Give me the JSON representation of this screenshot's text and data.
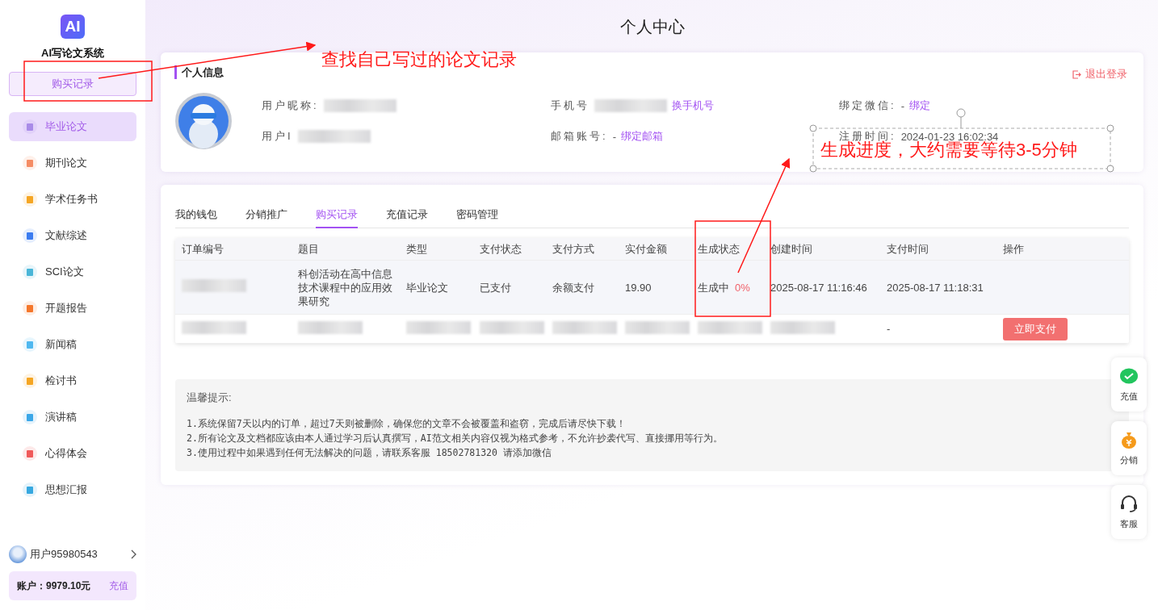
{
  "sidebar": {
    "logo": "AI",
    "app_name": "AI写论文系统",
    "top_button": "购买记录",
    "items": [
      {
        "label": "毕业论文",
        "selected": true,
        "color": "#a98be8"
      },
      {
        "label": "期刊论文",
        "selected": false,
        "color": "#f58c64"
      },
      {
        "label": "学术任务书",
        "selected": false,
        "color": "#f5a623"
      },
      {
        "label": "文献综述",
        "selected": false,
        "color": "#3b7cf0"
      },
      {
        "label": "SCI论文",
        "selected": false,
        "color": "#4ab6d8"
      },
      {
        "label": "开题报告",
        "selected": false,
        "color": "#f5772b"
      },
      {
        "label": "新闻稿",
        "selected": false,
        "color": "#4fb8f0"
      },
      {
        "label": "检讨书",
        "selected": false,
        "color": "#f5a623"
      },
      {
        "label": "演讲稿",
        "selected": false,
        "color": "#3aa7e8"
      },
      {
        "label": "心得体会",
        "selected": false,
        "color": "#f05a5a"
      },
      {
        "label": "思想汇报",
        "selected": false,
        "color": "#36a8e0"
      }
    ],
    "user": "用户95980543",
    "balance": "账户：9979.10元",
    "recharge": "充值"
  },
  "page_title": "个人中心",
  "profile": {
    "title": "个人信息",
    "logout": "退出登录",
    "fields": [
      {
        "label": "用户昵称:",
        "blurred": true
      },
      {
        "label": "手机号",
        "blurred": true,
        "link": "换手机号"
      },
      {
        "label": "绑定微信:",
        "value": "-",
        "link": "绑定"
      },
      {
        "label": "用户I",
        "blurred": true
      },
      {
        "label": "邮箱账号:",
        "value": "-",
        "link": "绑定邮箱"
      },
      {
        "label": "注册时间:",
        "value": "2024-01-23 16:02:34"
      }
    ]
  },
  "tabs": [
    {
      "label": "我的钱包",
      "selected": false
    },
    {
      "label": "分销推广",
      "selected": false
    },
    {
      "label": "购买记录",
      "selected": true
    },
    {
      "label": "充值记录",
      "selected": false
    },
    {
      "label": "密码管理",
      "selected": false
    }
  ],
  "table": {
    "columns": [
      "订单编号",
      "题目",
      "类型",
      "支付状态",
      "支付方式",
      "实付金额",
      "生成状态",
      "创建时间",
      "支付时间",
      "操作"
    ],
    "rows": [
      [
        {
          "kind": "blurred"
        },
        {
          "kind": "text",
          "text": "科创活动在高中信息技术课程中的应用效果研究"
        },
        {
          "kind": "text",
          "text": "毕业论文"
        },
        {
          "kind": "text",
          "text": "已支付"
        },
        {
          "kind": "text",
          "text": "余额支付"
        },
        {
          "kind": "text",
          "text": "19.90"
        },
        {
          "kind": "progress",
          "text": "生成中",
          "progress": "0%"
        },
        {
          "kind": "text",
          "text": "2025-08-17 11:16:46"
        },
        {
          "kind": "text",
          "text": "2025-08-17 11:18:31"
        },
        {
          "kind": "empty"
        }
      ],
      [
        {
          "kind": "blurred"
        },
        {
          "kind": "blurred"
        },
        {
          "kind": "blurred"
        },
        {
          "kind": "blurred"
        },
        {
          "kind": "blurred"
        },
        {
          "kind": "blurred"
        },
        {
          "kind": "blurred"
        },
        {
          "kind": "blurred"
        },
        {
          "kind": "text",
          "text": "-"
        },
        {
          "kind": "button",
          "text": "立即支付"
        }
      ]
    ]
  },
  "tips": {
    "title": "温馨提示:",
    "lines": [
      "1.系统保留7天以内的订单，超过7天则被删除，确保您的文章不会被覆盖和盗窃，完成后请尽快下载！",
      "2.所有论文及文档都应该由本人通过学习后认真撰写，AI范文相关内容仅视为格式参考，不允许抄袭代写、直接挪用等行为。",
      "3.使用过程中如果遇到任何无法解决的问题，请联系客服 18502781320 请添加微信"
    ]
  },
  "float_buttons": [
    {
      "kind": "wechat",
      "label": "充值"
    },
    {
      "kind": "money",
      "label": "分销"
    },
    {
      "kind": "support",
      "label": "客服"
    }
  ],
  "annotations": {
    "note_1": "查找自己写过的论文记录",
    "note_2": "生成进度，大约需要等待3-5分钟"
  }
}
